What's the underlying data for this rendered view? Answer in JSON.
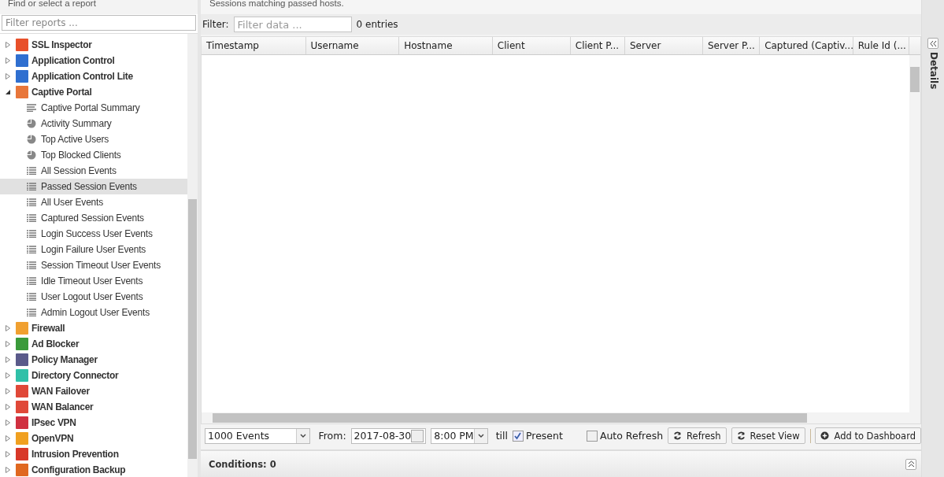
{
  "sidebar": {
    "title": "Find or select a report",
    "search": {
      "placeholder": "Filter reports ..."
    },
    "items": [
      {
        "label": "SSL Inspector",
        "color": "#e8502a",
        "expanded": false
      },
      {
        "label": "Application Control",
        "color": "#2f6fd0",
        "expanded": false
      },
      {
        "label": "Application Control Lite",
        "color": "#2f6fd0",
        "expanded": false
      },
      {
        "label": "Captive Portal",
        "color": "#e8763a",
        "expanded": true,
        "children": [
          {
            "label": "Captive Portal Summary",
            "kind": "text",
            "selected": false
          },
          {
            "label": "Activity Summary",
            "kind": "pie",
            "selected": false
          },
          {
            "label": "Top Active Users",
            "kind": "pie",
            "selected": false
          },
          {
            "label": "Top Blocked Clients",
            "kind": "pie",
            "selected": false
          },
          {
            "label": "All Session Events",
            "kind": "list",
            "selected": false
          },
          {
            "label": "Passed Session Events",
            "kind": "list",
            "selected": true
          },
          {
            "label": "All User Events",
            "kind": "list",
            "selected": false
          },
          {
            "label": "Captured Session Events",
            "kind": "list",
            "selected": false
          },
          {
            "label": "Login Success User Events",
            "kind": "list",
            "selected": false
          },
          {
            "label": "Login Failure User Events",
            "kind": "list",
            "selected": false
          },
          {
            "label": "Session Timeout User Events",
            "kind": "list",
            "selected": false
          },
          {
            "label": "Idle Timeout User Events",
            "kind": "list",
            "selected": false
          },
          {
            "label": "User Logout User Events",
            "kind": "list",
            "selected": false
          },
          {
            "label": "Admin Logout User Events",
            "kind": "list",
            "selected": false
          }
        ]
      },
      {
        "label": "Firewall",
        "color": "#f0a030",
        "expanded": false
      },
      {
        "label": "Ad Blocker",
        "color": "#3a9a3a",
        "expanded": false
      },
      {
        "label": "Policy Manager",
        "color": "#5a5a8a",
        "expanded": false
      },
      {
        "label": "Directory Connector",
        "color": "#30c0a8",
        "expanded": false
      },
      {
        "label": "WAN Failover",
        "color": "#e04838",
        "expanded": false
      },
      {
        "label": "WAN Balancer",
        "color": "#e04838",
        "expanded": false
      },
      {
        "label": "IPsec VPN",
        "color": "#d03040",
        "expanded": false
      },
      {
        "label": "OpenVPN",
        "color": "#f0a020",
        "expanded": false
      },
      {
        "label": "Intrusion Prevention",
        "color": "#d83828",
        "expanded": false
      },
      {
        "label": "Configuration Backup",
        "color": "#e06820",
        "expanded": false
      }
    ]
  },
  "report": {
    "description": "Sessions matching passed hosts.",
    "filter_label": "Filter:",
    "filter": {
      "placeholder": "Filter data ..."
    },
    "count": "0 entries",
    "columns": [
      "Timestamp",
      "Username",
      "Hostname",
      "Client",
      "Client P...",
      "Server",
      "Server P...",
      "Captured (Captiv...",
      "Rule Id (..."
    ],
    "toolbar": {
      "limit": "1000 Events",
      "from_label": "From:",
      "date": "2017-08-30",
      "time": "8:00 PM",
      "till_label": "till",
      "present": {
        "label": "Present",
        "checked": true
      },
      "auto_refresh": {
        "label": "Auto Refresh",
        "checked": false
      },
      "buttons": [
        "Refresh",
        "Reset View",
        "Add to Dashboard"
      ]
    },
    "conditions": "Conditions: 0"
  },
  "details_panel": {
    "title": "Details"
  }
}
